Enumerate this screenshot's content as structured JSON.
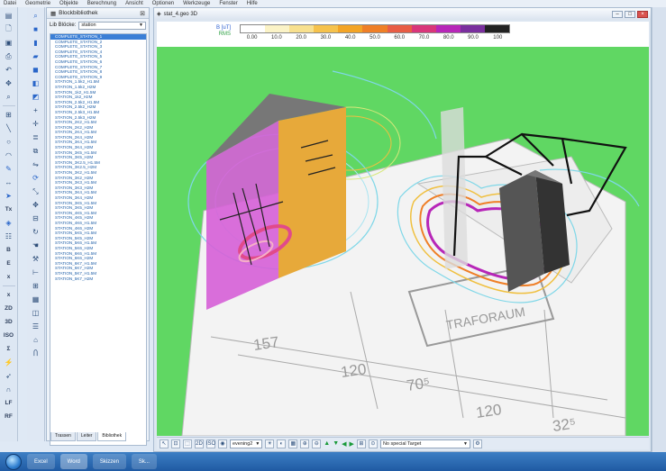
{
  "window": {
    "menu": [
      "Datei",
      "Geometrie",
      "Objekte",
      "Berechnung",
      "Ansicht",
      "Optionen",
      "Werkzeuge",
      "Fenster",
      "Hilfe"
    ]
  },
  "library": {
    "title": "Blockbibliothek",
    "filter_label": "Lib Blöcke:",
    "filter_value": "station",
    "items": [
      "COMPLETE_STATION_1",
      "COMPLETE_STATION_2",
      "COMPLETE_STATION_3",
      "COMPLETE_STATION_4",
      "COMPLETE_STATION_5",
      "COMPLETE_STATION_6",
      "COMPLETE_STATION_7",
      "COMPLETE_STATION_8",
      "COMPLETE_STATION_9",
      "STATION_1.5k2_H1.5M",
      "STATION_1.5k2_H2M",
      "STATION_1k2_H1.5M",
      "STATION_1k2_H2M",
      "STATION_2.5k2_H1.5M",
      "STATION_2.5k2_H2M",
      "STATION_2.5k3_H1.5M",
      "STATION_2.5k3_H2M",
      "STATION_2K2_H1.5M",
      "STATION_2K2_H2M",
      "STATION_2K4_H1.5M",
      "STATION_2K4_H2M",
      "STATION_3K4_H1.5M",
      "STATION_3K4_H2M",
      "STATION_3K5_H1.5M",
      "STATION_3K5_H2M",
      "STATION_3K2.5_H1.5M",
      "STATION_3K2.5_H2M",
      "STATION_3K2_H1.5M",
      "STATION_3K2_H2M",
      "STATION_3K3_H1.5M",
      "STATION_3K3_H2M",
      "STATION_3K4_H1.5M",
      "STATION_3K4_H2M",
      "STATION_3K5_H1.5M",
      "STATION_3K5_H2M",
      "STATION_4K5_H1.5M",
      "STATION_4K5_H2M",
      "STATION_4K6_H1.5M",
      "STATION_4K6_H2M",
      "STATION_5K5_H1.5M",
      "STATION_5K5_H2M",
      "STATION_5K6_H1.5M",
      "STATION_5K6_H2M",
      "STATION_6K6_H1.5M",
      "STATION_6K6_H2M",
      "STATION_6K7_H1.5M",
      "STATION_6K7_H2M",
      "STATION_5K7_H1.5M",
      "STATION_5K7_H2M"
    ],
    "selected_index": 0,
    "tabs": [
      "Trassen",
      "Leiter",
      "Bibliothek"
    ]
  },
  "tools_left": [
    "Tx",
    "B",
    "E",
    "x",
    "ZD",
    "3D",
    "ISO",
    "Σ",
    "LF",
    "RF"
  ],
  "viewport": {
    "title": "stat_4.geo 3D",
    "legend": {
      "label_b": "B [uT]",
      "label_rms": "RMS",
      "ticks": [
        "0.00",
        "10.0",
        "20.0",
        "30.0",
        "40.0",
        "50.0",
        "60.0",
        "70.0",
        "80.0",
        "90.0",
        "100"
      ],
      "colors": [
        "#ffffff",
        "#fbf3c7",
        "#f8e08e",
        "#f6c24c",
        "#f3a426",
        "#ef7f27",
        "#e85d45",
        "#d9367a",
        "#b726b8",
        "#7a2f9e",
        "#222222"
      ]
    },
    "floor_labels": [
      "157",
      "120",
      "70⁵",
      "120",
      "32⁵",
      "TRAFORAUM"
    ],
    "status": {
      "view_preset": "evening2",
      "target": "No special Target"
    }
  },
  "taskbar": {
    "apps": [
      "Excel",
      "Word",
      "Skizzen",
      "Sk..."
    ]
  },
  "colors": {
    "scene_bg": "#60d763",
    "accent": "#3b7fd6"
  }
}
